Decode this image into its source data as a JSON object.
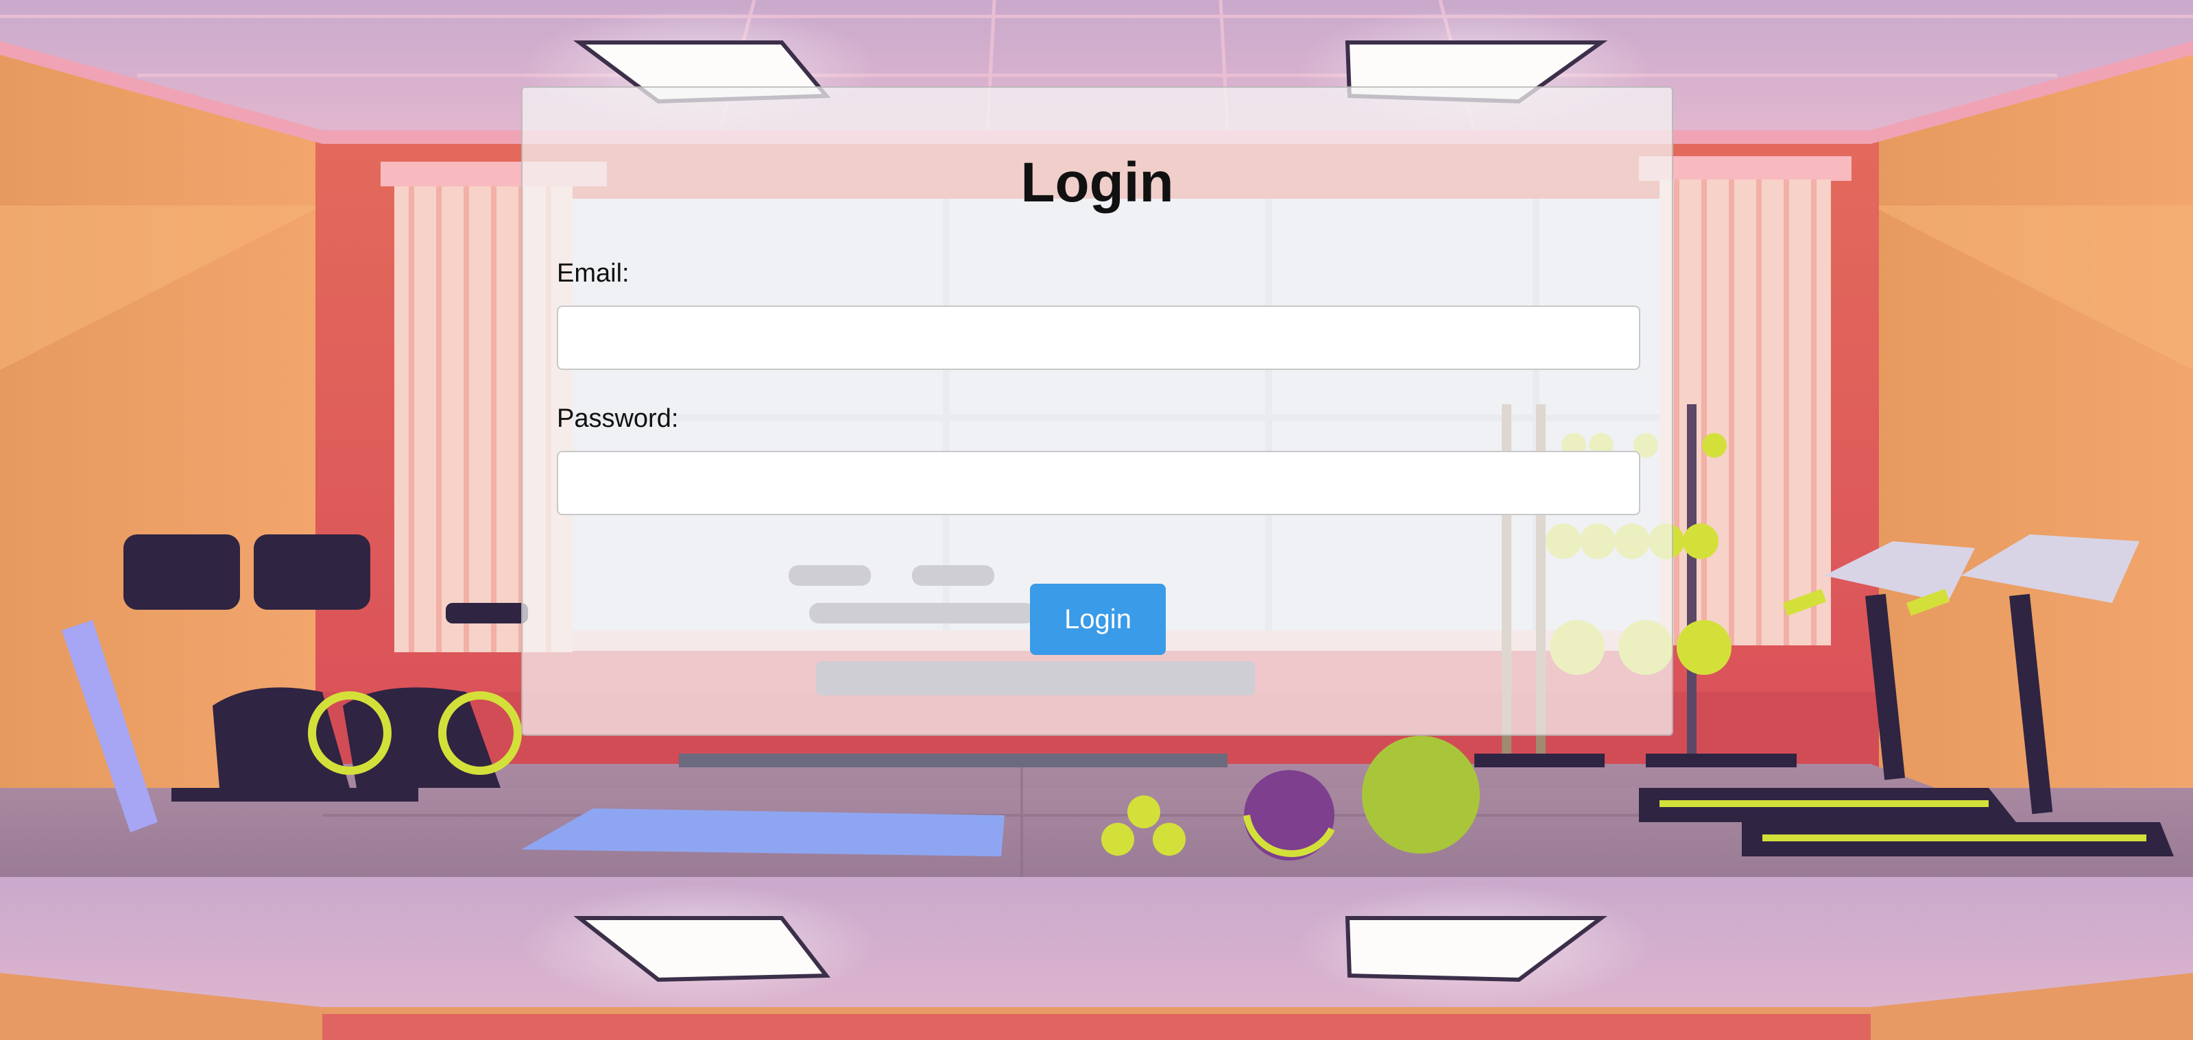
{
  "login_form": {
    "title": "Login",
    "email_label": "Email:",
    "email_value": "",
    "email_placeholder": "",
    "password_label": "Password:",
    "password_value": "",
    "password_placeholder": "",
    "submit_label": "Login"
  },
  "colors": {
    "button": "#3a9be8",
    "button_text": "#ffffff",
    "card_background": "#f5f5f5",
    "title_text": "#111111"
  },
  "background": {
    "scene": "gym-illustration"
  }
}
